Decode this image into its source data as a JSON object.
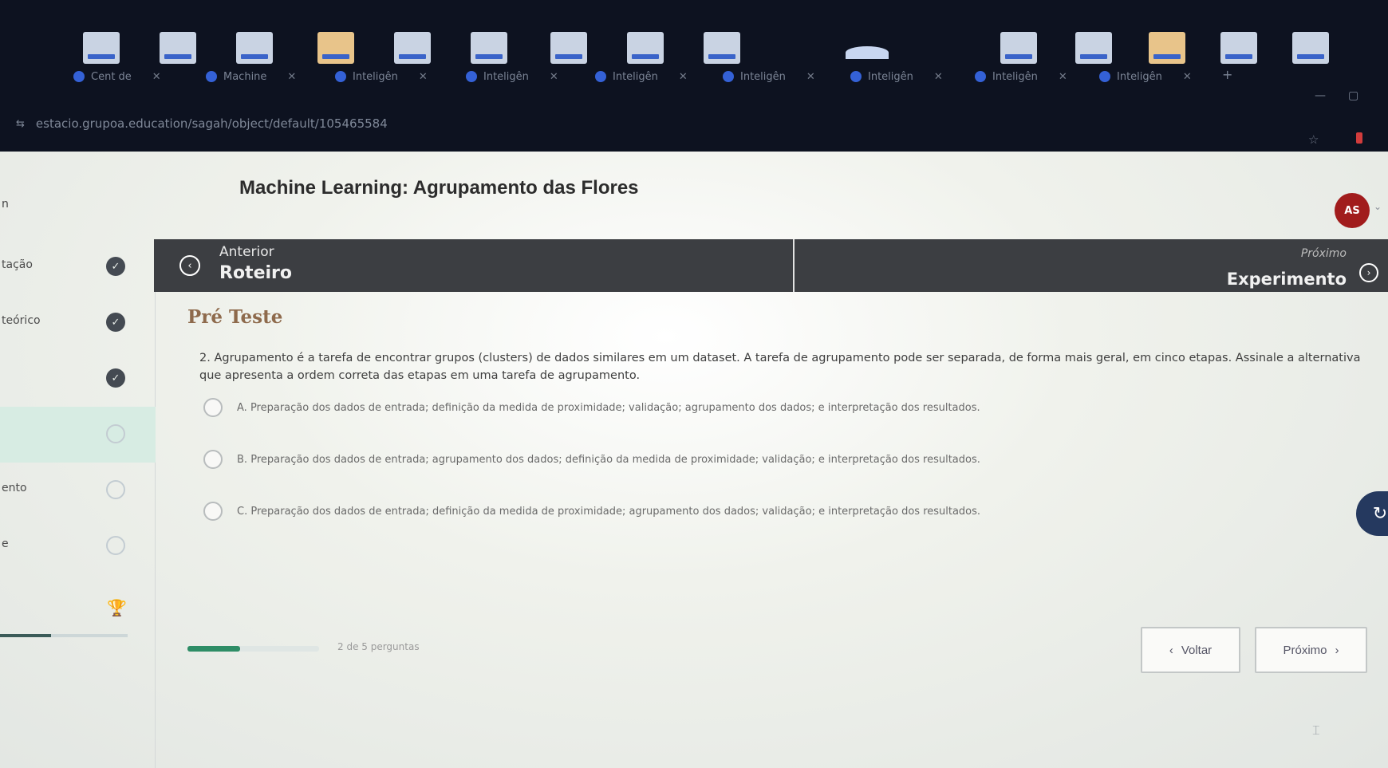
{
  "browser": {
    "tabs": [
      {
        "title": "Cent de"
      },
      {
        "title": "Machine"
      },
      {
        "title": "Inteligên"
      },
      {
        "title": "Inteligên"
      },
      {
        "title": "Inteligên"
      },
      {
        "title": "Inteligên"
      },
      {
        "title": "Inteligên"
      },
      {
        "title": "Inteligên"
      },
      {
        "title": "Inteligên"
      }
    ],
    "tab_close_glyph": "✕",
    "new_tab_glyph": "+",
    "minimize_glyph": "—",
    "maximize_glyph": "▢",
    "url": "estacio.grupoa.education/sagah/object/default/105465584",
    "star_glyph": "☆"
  },
  "header": {
    "left_marker": "n",
    "course_title": "Machine Learning: Agrupamento das Flores",
    "avatar_initials": "AS",
    "avatar_chevron": "⌄"
  },
  "sidebar": {
    "items": [
      {
        "label": "tação",
        "status": "done"
      },
      {
        "label": "teórico",
        "status": "done"
      },
      {
        "label": "",
        "status": "done"
      },
      {
        "label": "",
        "status": "todo",
        "active": true
      },
      {
        "label": "ento",
        "status": "todo"
      },
      {
        "label": "e",
        "status": "todo"
      }
    ],
    "check_glyph": "✓",
    "trophy_glyph": "🏆"
  },
  "nav": {
    "prev_label": "Anterior",
    "prev_title": "Roteiro",
    "prev_glyph": "‹",
    "next_label": "Próximo",
    "next_title": "Experimento",
    "next_glyph": "›"
  },
  "quiz": {
    "section_title": "Pré Teste",
    "question": "2. Agrupamento é a tarefa de encontrar grupos (clusters) de dados similares em um dataset. A tarefa de agrupamento pode ser separada, de forma mais geral, em cinco etapas. Assinale a alternativa que apresenta a ordem correta das etapas em uma tarefa de agrupamento.",
    "options": [
      {
        "letter": "A.",
        "text": "Preparação dos dados de entrada; definição da medida de proximidade; validação; agrupamento dos dados; e interpretação dos resultados."
      },
      {
        "letter": "B.",
        "text": "Preparação dos dados de entrada; agrupamento dos dados; definição da medida de proximidade; validação; e interpretação dos resultados."
      },
      {
        "letter": "C.",
        "text": "Preparação dos dados de entrada; definição da medida de proximidade; agrupamento dos dados; validação; e interpretação dos resultados."
      }
    ],
    "progress_text": "2 de 5 perguntas",
    "progress_fraction": 0.4,
    "back_label": "Voltar",
    "back_glyph": "‹",
    "next_label": "Próximo",
    "next_glyph": "›",
    "float_glyph": "↻"
  }
}
